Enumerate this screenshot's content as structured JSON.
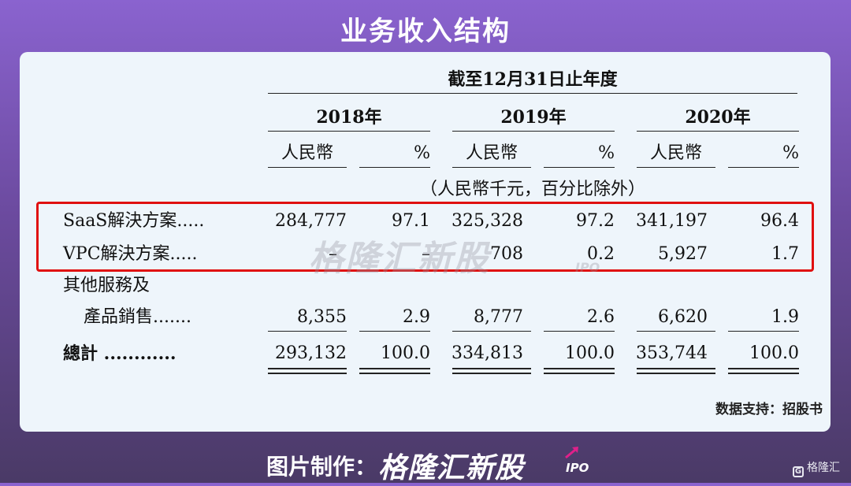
{
  "title": "业务收入结构",
  "table": {
    "period_header": "截至12月31日止年度",
    "years": [
      "2018年",
      "2019年",
      "2020年"
    ],
    "currency_label": "人民幣",
    "percent_label": "%",
    "unit_note": "（人民幣千元，百分比除外）",
    "rows": [
      {
        "label": "SaaS解決方案.....",
        "values": [
          "284,777",
          "97.1",
          "325,328",
          "97.2",
          "341,197",
          "96.4"
        ]
      },
      {
        "label": "VPC解決方案.....",
        "values": [
          "–",
          "–",
          "708",
          "0.2",
          "5,927",
          "1.7"
        ]
      },
      {
        "label_line1": "其他服務及",
        "label": "產品銷售.......",
        "values": [
          "8,355",
          "2.9",
          "8,777",
          "2.6",
          "6,620",
          "1.9"
        ]
      },
      {
        "label": "總計 ............",
        "values": [
          "293,132",
          "100.0",
          "334,813",
          "100.0",
          "353,744",
          "100.0"
        ]
      }
    ]
  },
  "watermark": {
    "text": "格隆汇新股",
    "suffix": "IPO"
  },
  "source": "数据支持：招股书",
  "footer": {
    "label": "图片制作：",
    "brand": "格隆汇新股",
    "suffix": "IPO"
  },
  "corner_logo": {
    "icon": "G",
    "text": "格隆汇"
  }
}
